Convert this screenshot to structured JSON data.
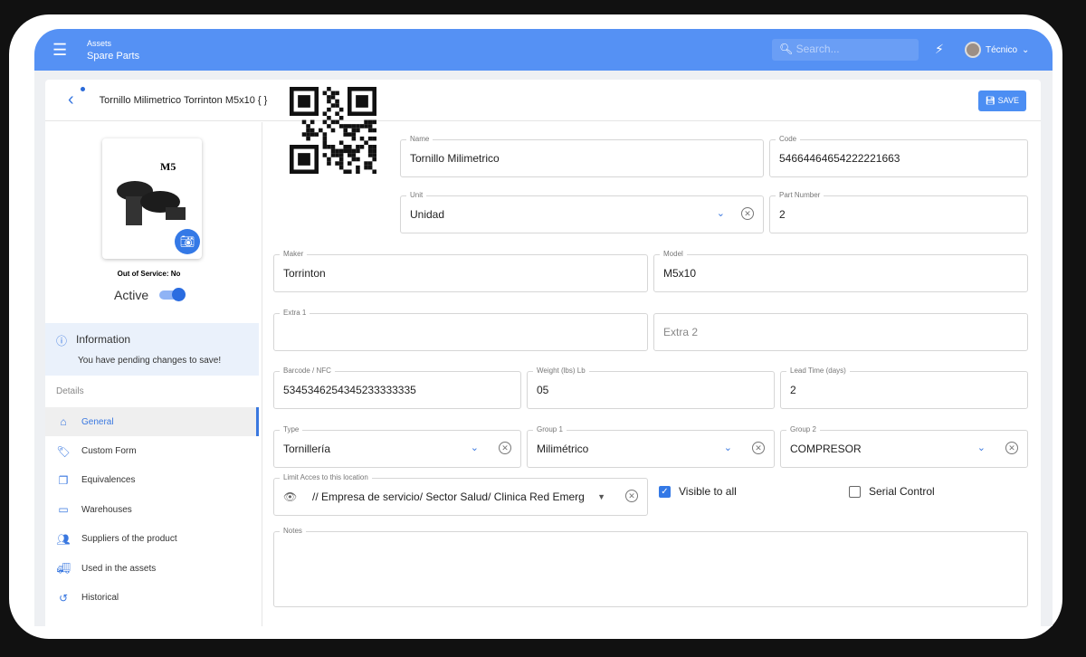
{
  "header": {
    "section": "Assets",
    "subsection": "Spare Parts",
    "search_placeholder": "Search...",
    "user": "Técnico"
  },
  "page": {
    "title": "Tornillo Milimetrico Torrinton M5x10 { }",
    "save_label": "SAVE"
  },
  "sidebar": {
    "photo_label": "M5",
    "out_of_service": "Out of Service: No",
    "active_label": "Active",
    "active": true,
    "info_title": "Information",
    "info_text": "You have pending changes to save!",
    "details_label": "Details",
    "items": [
      {
        "label": "General",
        "icon": "home-icon"
      },
      {
        "label": "Custom Form",
        "icon": "tags-icon"
      },
      {
        "label": "Equivalences",
        "icon": "copy-icon"
      },
      {
        "label": "Warehouses",
        "icon": "inbox-icon"
      },
      {
        "label": "Suppliers of the product",
        "icon": "users-icon"
      },
      {
        "label": "Used in the assets",
        "icon": "truck-icon"
      },
      {
        "label": "Historical",
        "icon": "history-icon"
      }
    ]
  },
  "form": {
    "name": {
      "label": "Name",
      "value": "Tornillo Milimetrico"
    },
    "code": {
      "label": "Code",
      "value": "54664464654222221663"
    },
    "unit": {
      "label": "Unit",
      "value": "Unidad"
    },
    "part_number": {
      "label": "Part Number",
      "value": "2"
    },
    "maker": {
      "label": "Maker",
      "value": "Torrinton"
    },
    "model": {
      "label": "Model",
      "value": "M5x10"
    },
    "extra1": {
      "label": "Extra 1",
      "value": ""
    },
    "extra2": {
      "placeholder": "Extra 2"
    },
    "barcode": {
      "label": "Barcode / NFC",
      "value": "5345346254345233333335"
    },
    "weight": {
      "label": "Weight (lbs) Lb",
      "value": "05"
    },
    "lead_time": {
      "label": "Lead Time (days)",
      "value": "2"
    },
    "type": {
      "label": "Type",
      "value": "Tornillería"
    },
    "group1": {
      "label": "Group 1",
      "value": "Milimétrico"
    },
    "group2": {
      "label": "Group 2",
      "value": "COMPRESOR"
    },
    "location": {
      "label": "Limit Acces to this location",
      "value": "// Empresa de servicio/ Sector Salud/  Clinica Red Emerg"
    },
    "visible_to_all": {
      "label": "Visible to all",
      "checked": true
    },
    "serial_control": {
      "label": "Serial Control",
      "checked": false
    },
    "notes": {
      "label": "Notes",
      "value": ""
    }
  }
}
